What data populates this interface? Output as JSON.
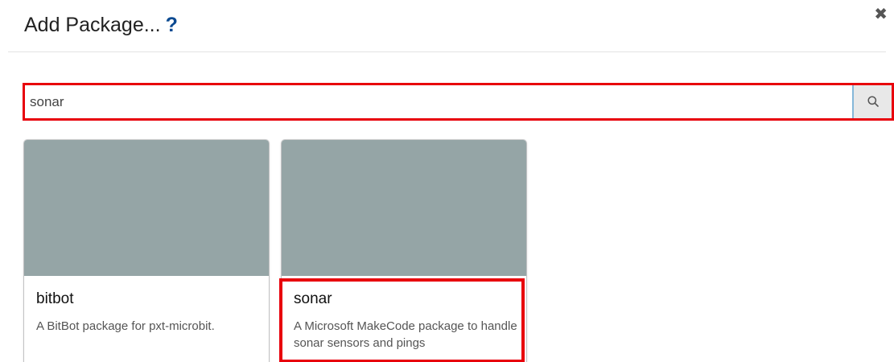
{
  "header": {
    "title": "Add Package...",
    "help_label": "?",
    "close_label": "✖"
  },
  "search": {
    "value": "sonar",
    "button_icon": "search-icon"
  },
  "packages": [
    {
      "name": "bitbot",
      "description": "A BitBot package for pxt-microbit."
    },
    {
      "name": "sonar",
      "description": "A Microsoft MakeCode package to handle sonar sensors and pings"
    }
  ],
  "colors": {
    "highlight": "#e8000b",
    "card_image": "#95a5a6",
    "help": "#0c4a91"
  }
}
